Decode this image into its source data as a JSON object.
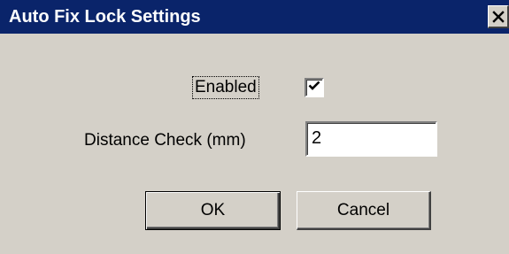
{
  "window": {
    "title": "Auto Fix Lock Settings",
    "close_icon": "close-icon",
    "colors": {
      "title_bar": "#0a246a",
      "title_text": "#ffffff",
      "face": "#d4d0c8"
    }
  },
  "form": {
    "enabled_label": "Enabled",
    "enabled_checked": true,
    "distance_label": "Distance Check (mm)",
    "distance_value": "2"
  },
  "buttons": {
    "ok_label": "OK",
    "cancel_label": "Cancel"
  }
}
